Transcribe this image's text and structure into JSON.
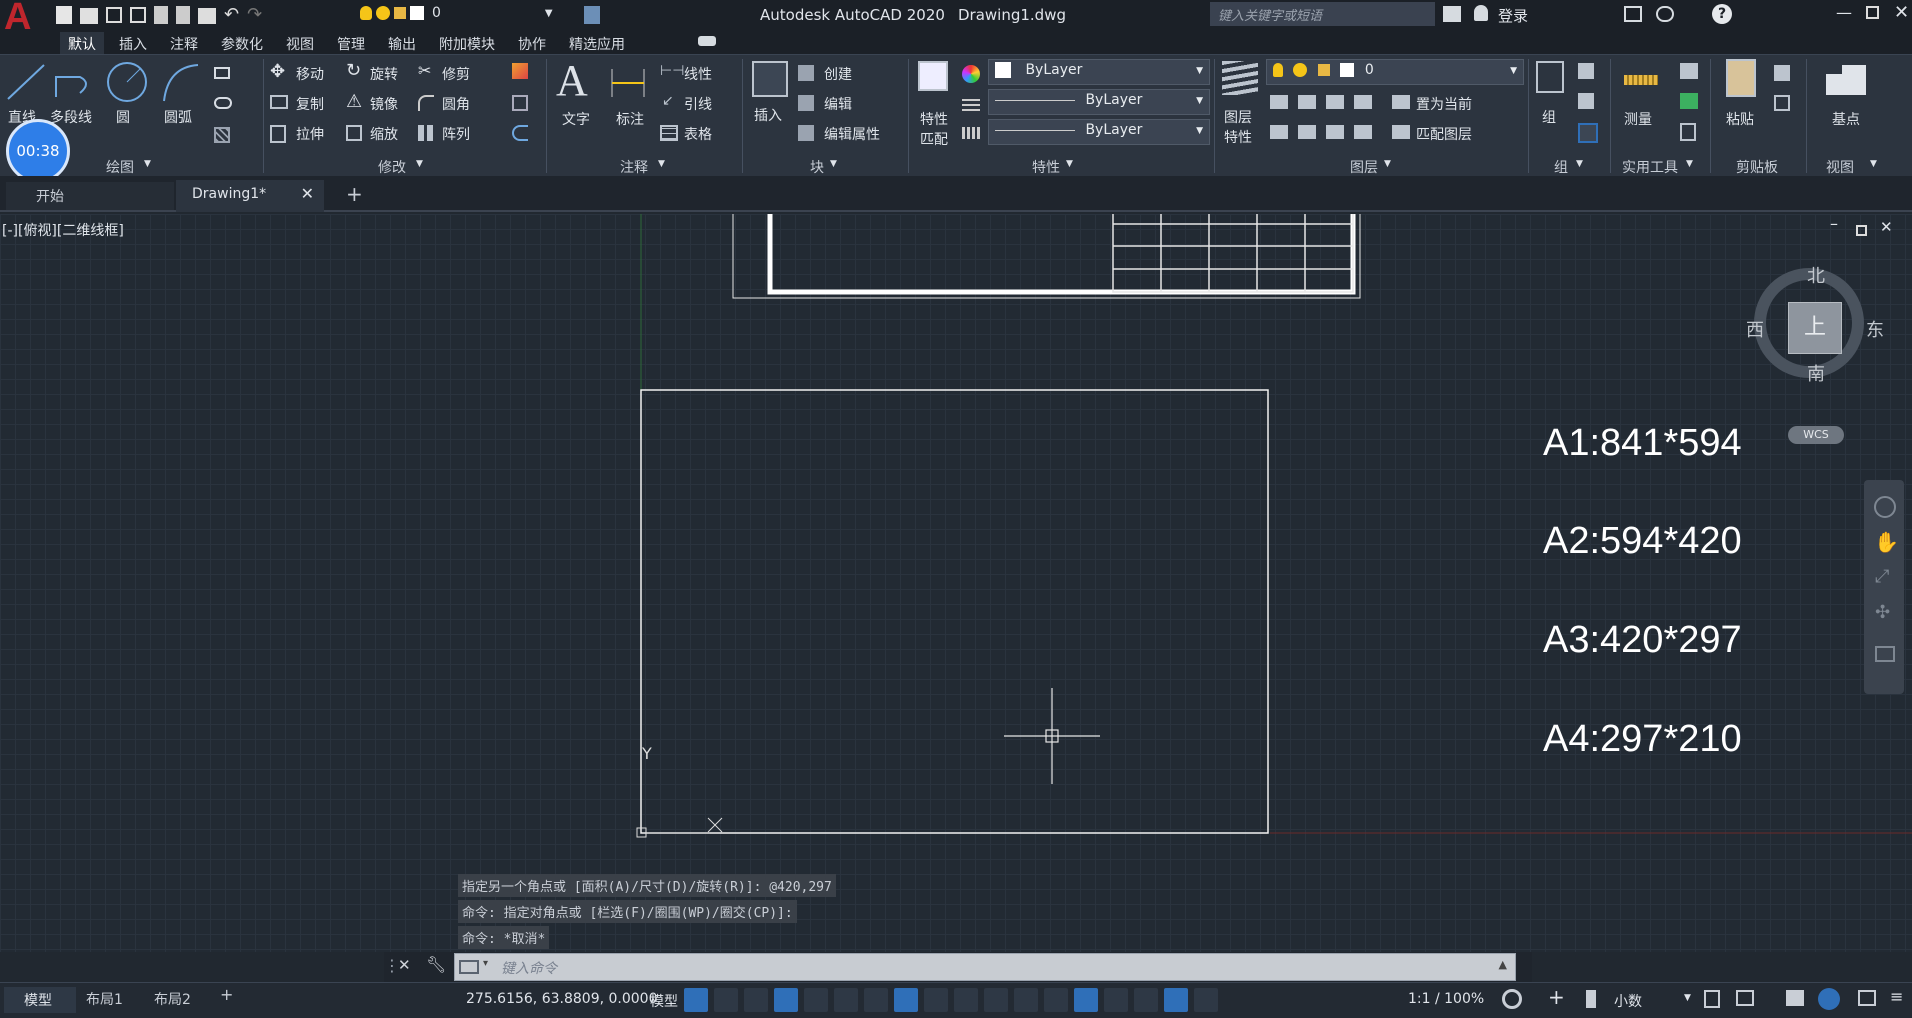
{
  "app": {
    "logo": "A",
    "title": "Autodesk AutoCAD 2020",
    "filename": "Drawing1.dwg",
    "search_placeholder": "键入关键字或短语",
    "login": "登录",
    "quick_layer": "0"
  },
  "menu_tabs": [
    "默认",
    "插入",
    "注释",
    "参数化",
    "视图",
    "管理",
    "输出",
    "附加模块",
    "协作",
    "精选应用"
  ],
  "active_tab": "默认",
  "ribbon": {
    "draw": {
      "line": "直线",
      "polyline": "多段线",
      "circle": "圆",
      "arc": "圆弧",
      "title": "绘图"
    },
    "timer": "00:38",
    "modify": {
      "move": "移动",
      "rotate": "旋转",
      "trim": "修剪",
      "copy": "复制",
      "mirror": "镜像",
      "fillet": "圆角",
      "stretch": "拉伸",
      "scale": "缩放",
      "array": "阵列",
      "title": "修改"
    },
    "annotation": {
      "text": "文字",
      "dimension": "标注",
      "linear": "线性",
      "leader": "引线",
      "table": "表格",
      "title": "注释"
    },
    "block": {
      "insert": "插入",
      "create": "创建",
      "edit": "编辑",
      "edit_attr": "编辑属性",
      "title": "块"
    },
    "properties": {
      "match1": "特性",
      "match2": "匹配",
      "color": "ByLayer",
      "linetype": "ByLayer",
      "lineweight": "ByLayer",
      "title": "特性"
    },
    "layers": {
      "layer_props1": "图层",
      "layer_props2": "特性",
      "current_layer": "0",
      "set_current": "置为当前",
      "match_layer": "匹配图层",
      "title": "图层"
    },
    "groups": {
      "group": "组",
      "title": "组"
    },
    "utilities": {
      "measure": "测量",
      "title": "实用工具"
    },
    "clipboard": {
      "paste": "粘贴",
      "title": "剪贴板"
    },
    "view": {
      "base": "基点",
      "title": "视图"
    }
  },
  "doc_tabs": [
    {
      "label": "开始"
    },
    {
      "label": "Drawing1*"
    }
  ],
  "viewport": {
    "label": "[-][俯视][二维线框]",
    "compass": {
      "north": "北",
      "south": "南",
      "east": "东",
      "west": "西",
      "top": "上",
      "wcs": "WCS"
    },
    "sizes": [
      "A1:841*594",
      "A2:594*420",
      "A3:420*297",
      "A4:297*210"
    ],
    "ucs_y": "Y"
  },
  "command": {
    "history": [
      "指定另一个角点或 [面积(A)/尺寸(D)/旋转(R)]: @420,297",
      "命令: 指定对角点或 [栏选(F)/圈围(WP)/圈交(CP)]:",
      "命令: *取消*"
    ],
    "placeholder": "键入命令"
  },
  "status": {
    "layout_tabs": [
      "模型",
      "布局1",
      "布局2"
    ],
    "coords": "275.6156, 63.8809, 0.0000",
    "model": "模型",
    "scale": "1:1 / 100%",
    "units": "小数"
  },
  "colors": {
    "accent": "#2f6fb8",
    "logo_red": "#c0262d",
    "background": "#212830"
  }
}
